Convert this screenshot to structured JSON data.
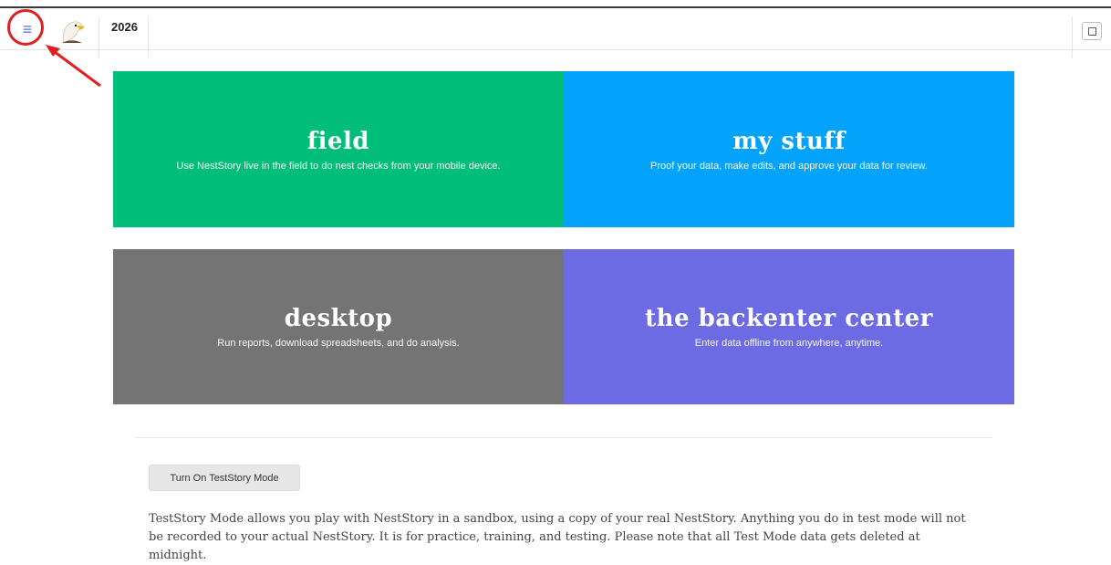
{
  "header": {
    "menu_icon": "hamburger-icon",
    "logo": "eagle-logo",
    "year": "2026",
    "calendar_icon": "calendar-icon"
  },
  "annotation": {
    "color": "#e02020"
  },
  "tiles": [
    {
      "title": "field",
      "subtitle": "Use NestStory live in the field to do nest checks from your mobile device.",
      "color": "#00bd79"
    },
    {
      "title": "my stuff",
      "subtitle": "Proof your data, make edits, and approve your data for review.",
      "color": "#03a2fb"
    },
    {
      "title": "desktop",
      "subtitle": "Run reports, download spreadsheets, and do analysis.",
      "color": "#747474"
    },
    {
      "title": "the backenter center",
      "subtitle": "Enter data offline from anywhere, anytime.",
      "color": "#6c6be3"
    }
  ],
  "testmode": {
    "button_label": "Turn On TestStory Mode",
    "description": "TestStory Mode allows you play with NestStory in a sandbox, using a copy of your real NestStory. Anything you do in test mode will not be recorded to your actual NestStory. It is for practice, training, and testing. Please note that all Test Mode data gets deleted at midnight."
  }
}
